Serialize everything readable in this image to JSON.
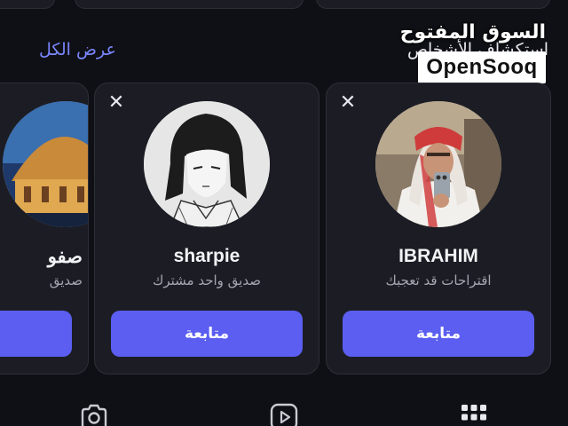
{
  "section": {
    "title": "استكشاف الأشخاص",
    "see_all": "عرض الكل"
  },
  "watermark": {
    "arabic": "السوق المفتوح",
    "latin": "OpenSooq"
  },
  "cards": [
    {
      "name": "IBRAHIM",
      "subtitle": "اقتراحات قد تعجبك",
      "follow_label": "متابعة",
      "close_glyph": "✕"
    },
    {
      "name": "sharpie",
      "subtitle": "صديق واحد مشترك",
      "follow_label": "متابعة",
      "close_glyph": "✕"
    },
    {
      "name": "صفو",
      "subtitle": "صديق",
      "follow_label": "",
      "close_glyph": ""
    }
  ],
  "bottom_nav": [
    {
      "icon": "grid-icon"
    },
    {
      "icon": "video-icon"
    },
    {
      "icon": "camera-icon"
    }
  ],
  "colors": {
    "background": "#0f1015",
    "card": "#1c1d24",
    "accent": "#5b5ef0",
    "link": "#7b86ff"
  }
}
